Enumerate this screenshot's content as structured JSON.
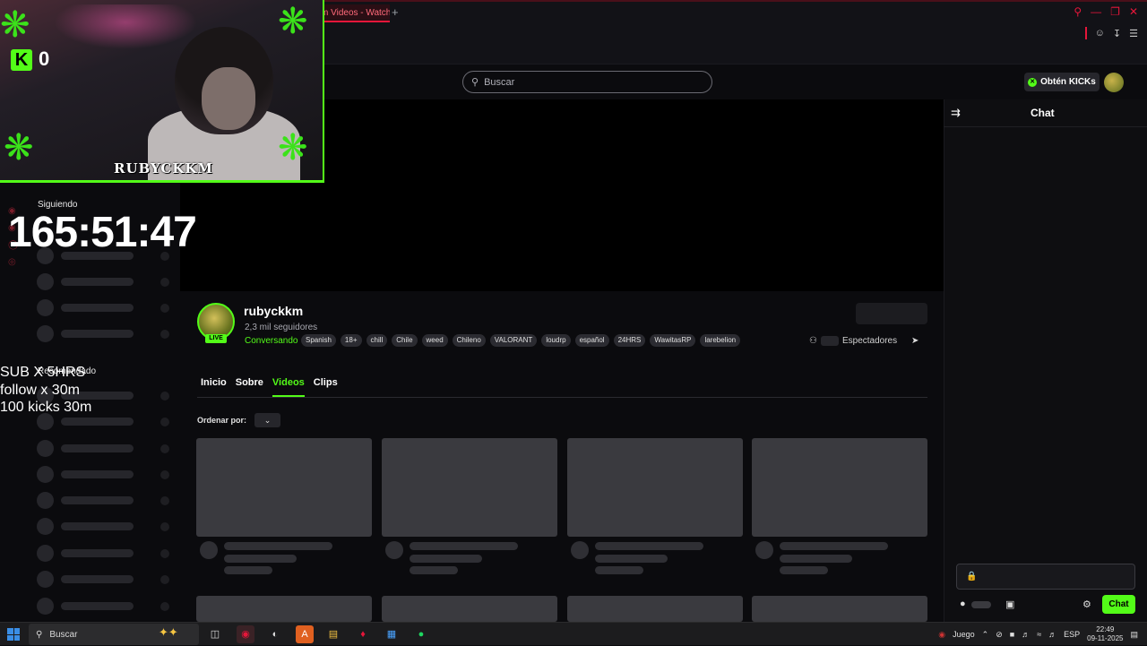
{
  "browser": {
    "tab_title": "m Videos - Watch",
    "new_tab": "+"
  },
  "header": {
    "search_placeholder": "Buscar",
    "get_kicks_label": "Obtén KICKs"
  },
  "overlay": {
    "kick_count": "0",
    "streamer_tag": "RUBYCKKM",
    "timer": "165:51:47",
    "goals": [
      "SUB X 5HRS",
      "follow x 30m",
      "100 kicks 30m"
    ]
  },
  "sidebar": {
    "following_label": "Siguiendo",
    "recommended_label": "Recomendado"
  },
  "channel": {
    "name": "rubyckkm",
    "followers": "2,3 mil seguidores",
    "category": "Conversando",
    "live_badge": "LIVE",
    "tags": [
      "Spanish",
      "18+",
      "chill",
      "Chile",
      "weed",
      "Chileno",
      "VALORANT",
      "loudrp",
      "español",
      "24HRS",
      "WawitasRP",
      "larebelion"
    ],
    "viewers_label": "Espectadores"
  },
  "channel_tabs": [
    "Inicio",
    "Sobre",
    "Videos",
    "Clips"
  ],
  "active_tab": "Videos",
  "videos": {
    "order_label": "Ordenar por:"
  },
  "chat": {
    "title": "Chat",
    "send_label": "Chat"
  },
  "taskbar": {
    "search_label": "Buscar",
    "game_label": "Juego",
    "language": "ESP",
    "time": "22:49",
    "date": "09-11-2025"
  },
  "colors": {
    "kick_green": "#53fc18",
    "accent_red": "#e5163a"
  }
}
